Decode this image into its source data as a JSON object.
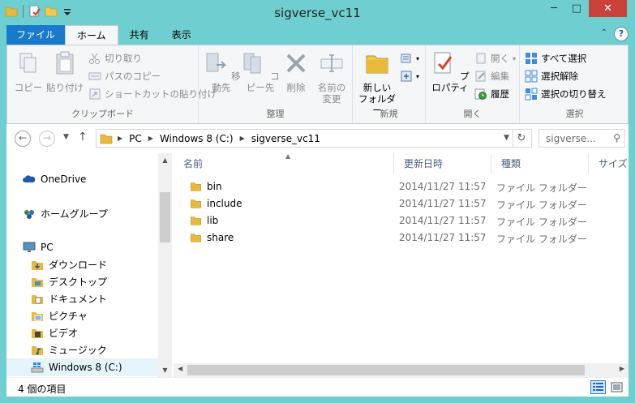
{
  "window": {
    "title": "sigverse_vc11"
  },
  "title_controls": {
    "minimize": "─",
    "maximize": "□",
    "close": "✕"
  },
  "tabs": [
    {
      "label": "ファイル"
    },
    {
      "label": "ホーム"
    },
    {
      "label": "共有"
    },
    {
      "label": "表示"
    }
  ],
  "ribbon": {
    "clipboard": {
      "label": "クリップボード",
      "copy": "コピー",
      "paste": "貼り付け",
      "cut": "切り取り",
      "copy_path": "パスのコピー",
      "paste_shortcut": "ショートカットの貼り付け"
    },
    "organize": {
      "label": "整理",
      "move_to": "移動先",
      "copy_to": "コピー先",
      "delete": "削除",
      "rename_line1": "名前の",
      "rename_line2": "変更"
    },
    "new": {
      "label": "新規",
      "new_folder_line1": "新しい",
      "new_folder_line2": "フォルダー"
    },
    "open": {
      "label": "開く",
      "properties": "プロパティ",
      "open": "開く",
      "edit": "編集",
      "history": "履歴"
    },
    "select": {
      "label": "選択",
      "select_all": "すべて選択",
      "select_none": "選択解除",
      "invert": "選択の切り替え"
    }
  },
  "address": {
    "crumbs": [
      "PC",
      "Windows 8 (C:)",
      "sigverse_vc11"
    ],
    "search_placeholder": "sigverse..."
  },
  "nav_pane": {
    "items": [
      {
        "label": "OneDrive"
      },
      {
        "label": "ホームグループ"
      },
      {
        "label": "PC"
      },
      {
        "label": "ダウンロード"
      },
      {
        "label": "デスクトップ"
      },
      {
        "label": "ドキュメント"
      },
      {
        "label": "ピクチャ"
      },
      {
        "label": "ビデオ"
      },
      {
        "label": "ミュージック"
      },
      {
        "label": "Windows 8 (C:)"
      }
    ]
  },
  "file_list": {
    "columns": [
      "名前",
      "更新日時",
      "種類",
      "サイズ"
    ],
    "rows": [
      {
        "name": "bin",
        "modified": "2014/11/27 11:57",
        "type": "ファイル フォルダー"
      },
      {
        "name": "include",
        "modified": "2014/11/27 11:57",
        "type": "ファイル フォルダー"
      },
      {
        "name": "lib",
        "modified": "2014/11/27 11:57",
        "type": "ファイル フォルダー"
      },
      {
        "name": "share",
        "modified": "2014/11/27 11:57",
        "type": "ファイル フォルダー"
      }
    ]
  },
  "status": {
    "text": "4 個の項目"
  },
  "colors": {
    "frame": "#6fcfd0",
    "file_tab": "#1979ca",
    "folder": "#e8b93a",
    "close": "#c8423a"
  }
}
